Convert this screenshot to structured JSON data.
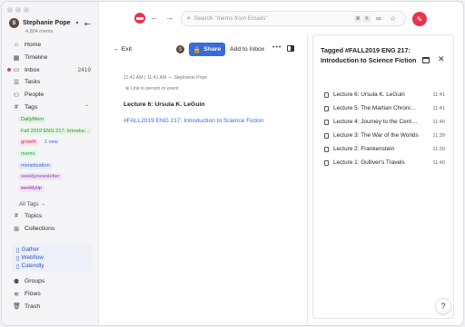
{
  "account": {
    "name": "Stephanie Pope",
    "initial": "S",
    "subtitle": "4,804 mems"
  },
  "nav": [
    {
      "label": "Home",
      "icon": "home-icon"
    },
    {
      "label": "Timeline",
      "icon": "calendar-icon"
    },
    {
      "label": "Inbox",
      "icon": "inbox-icon",
      "count": "2419"
    },
    {
      "label": "Tasks",
      "icon": "checklist-icon"
    },
    {
      "label": "People",
      "icon": "people-icon"
    },
    {
      "label": "Tags",
      "icon": "hash-icon"
    }
  ],
  "tags": [
    {
      "label": "DailyMem"
    },
    {
      "label": "Fall 2019 ENG 217: Introduc..."
    },
    {
      "label": "growth",
      "badge": "1 new"
    },
    {
      "label": "memo"
    },
    {
      "label": "monetization"
    },
    {
      "label": "weeklynewsletter"
    },
    {
      "label": "weeklytip"
    }
  ],
  "all_tags": "All Tags →",
  "nav2": [
    {
      "label": "Topics",
      "icon": "hash-icon"
    },
    {
      "label": "Collections",
      "icon": "grid-icon"
    }
  ],
  "links": [
    "Gather",
    "Webflow",
    "Calendly"
  ],
  "nav3": [
    {
      "label": "Groups",
      "icon": "groups-icon"
    },
    {
      "label": "Flows",
      "icon": "flows-icon"
    },
    {
      "label": "Trash",
      "icon": "trash-icon"
    }
  ],
  "search": {
    "placeholder": "Search \"mems from Emails\"",
    "kbd1": "⌘",
    "kbd2": "K"
  },
  "toolbar": {
    "exit": "Exit",
    "share": "Share",
    "add_to_inbox": "Add to Inbox",
    "more": "•••"
  },
  "note": {
    "meta": "11:41 AM | 11:41 AM — Stephanie Pope",
    "link_person": "Link to person or event",
    "title": "Lecture 6: Ursula K. LeGuin",
    "tag": "#FALL2019 ENG 217: Introduction to Science Fiction"
  },
  "panel": {
    "title": "Tagged #FALL2019 ENG 217: Introduction to Science Fiction",
    "items": [
      {
        "label": "Lecture 6: Ursula K. LeGuin",
        "time": "11:41"
      },
      {
        "label": "Lecture 5: The Martian Chronicles",
        "time": "11:41"
      },
      {
        "label": "Lecture 4: Journey to the Center of the Earth",
        "time": "11:40"
      },
      {
        "label": "Lecture 3: The War of the Worlds",
        "time": "11:39"
      },
      {
        "label": "Lecture 2: Frankenstein",
        "time": "11:39"
      },
      {
        "label": "Lecture 1: Gulliver's Travels",
        "time": "11:40"
      }
    ]
  },
  "help": "?"
}
